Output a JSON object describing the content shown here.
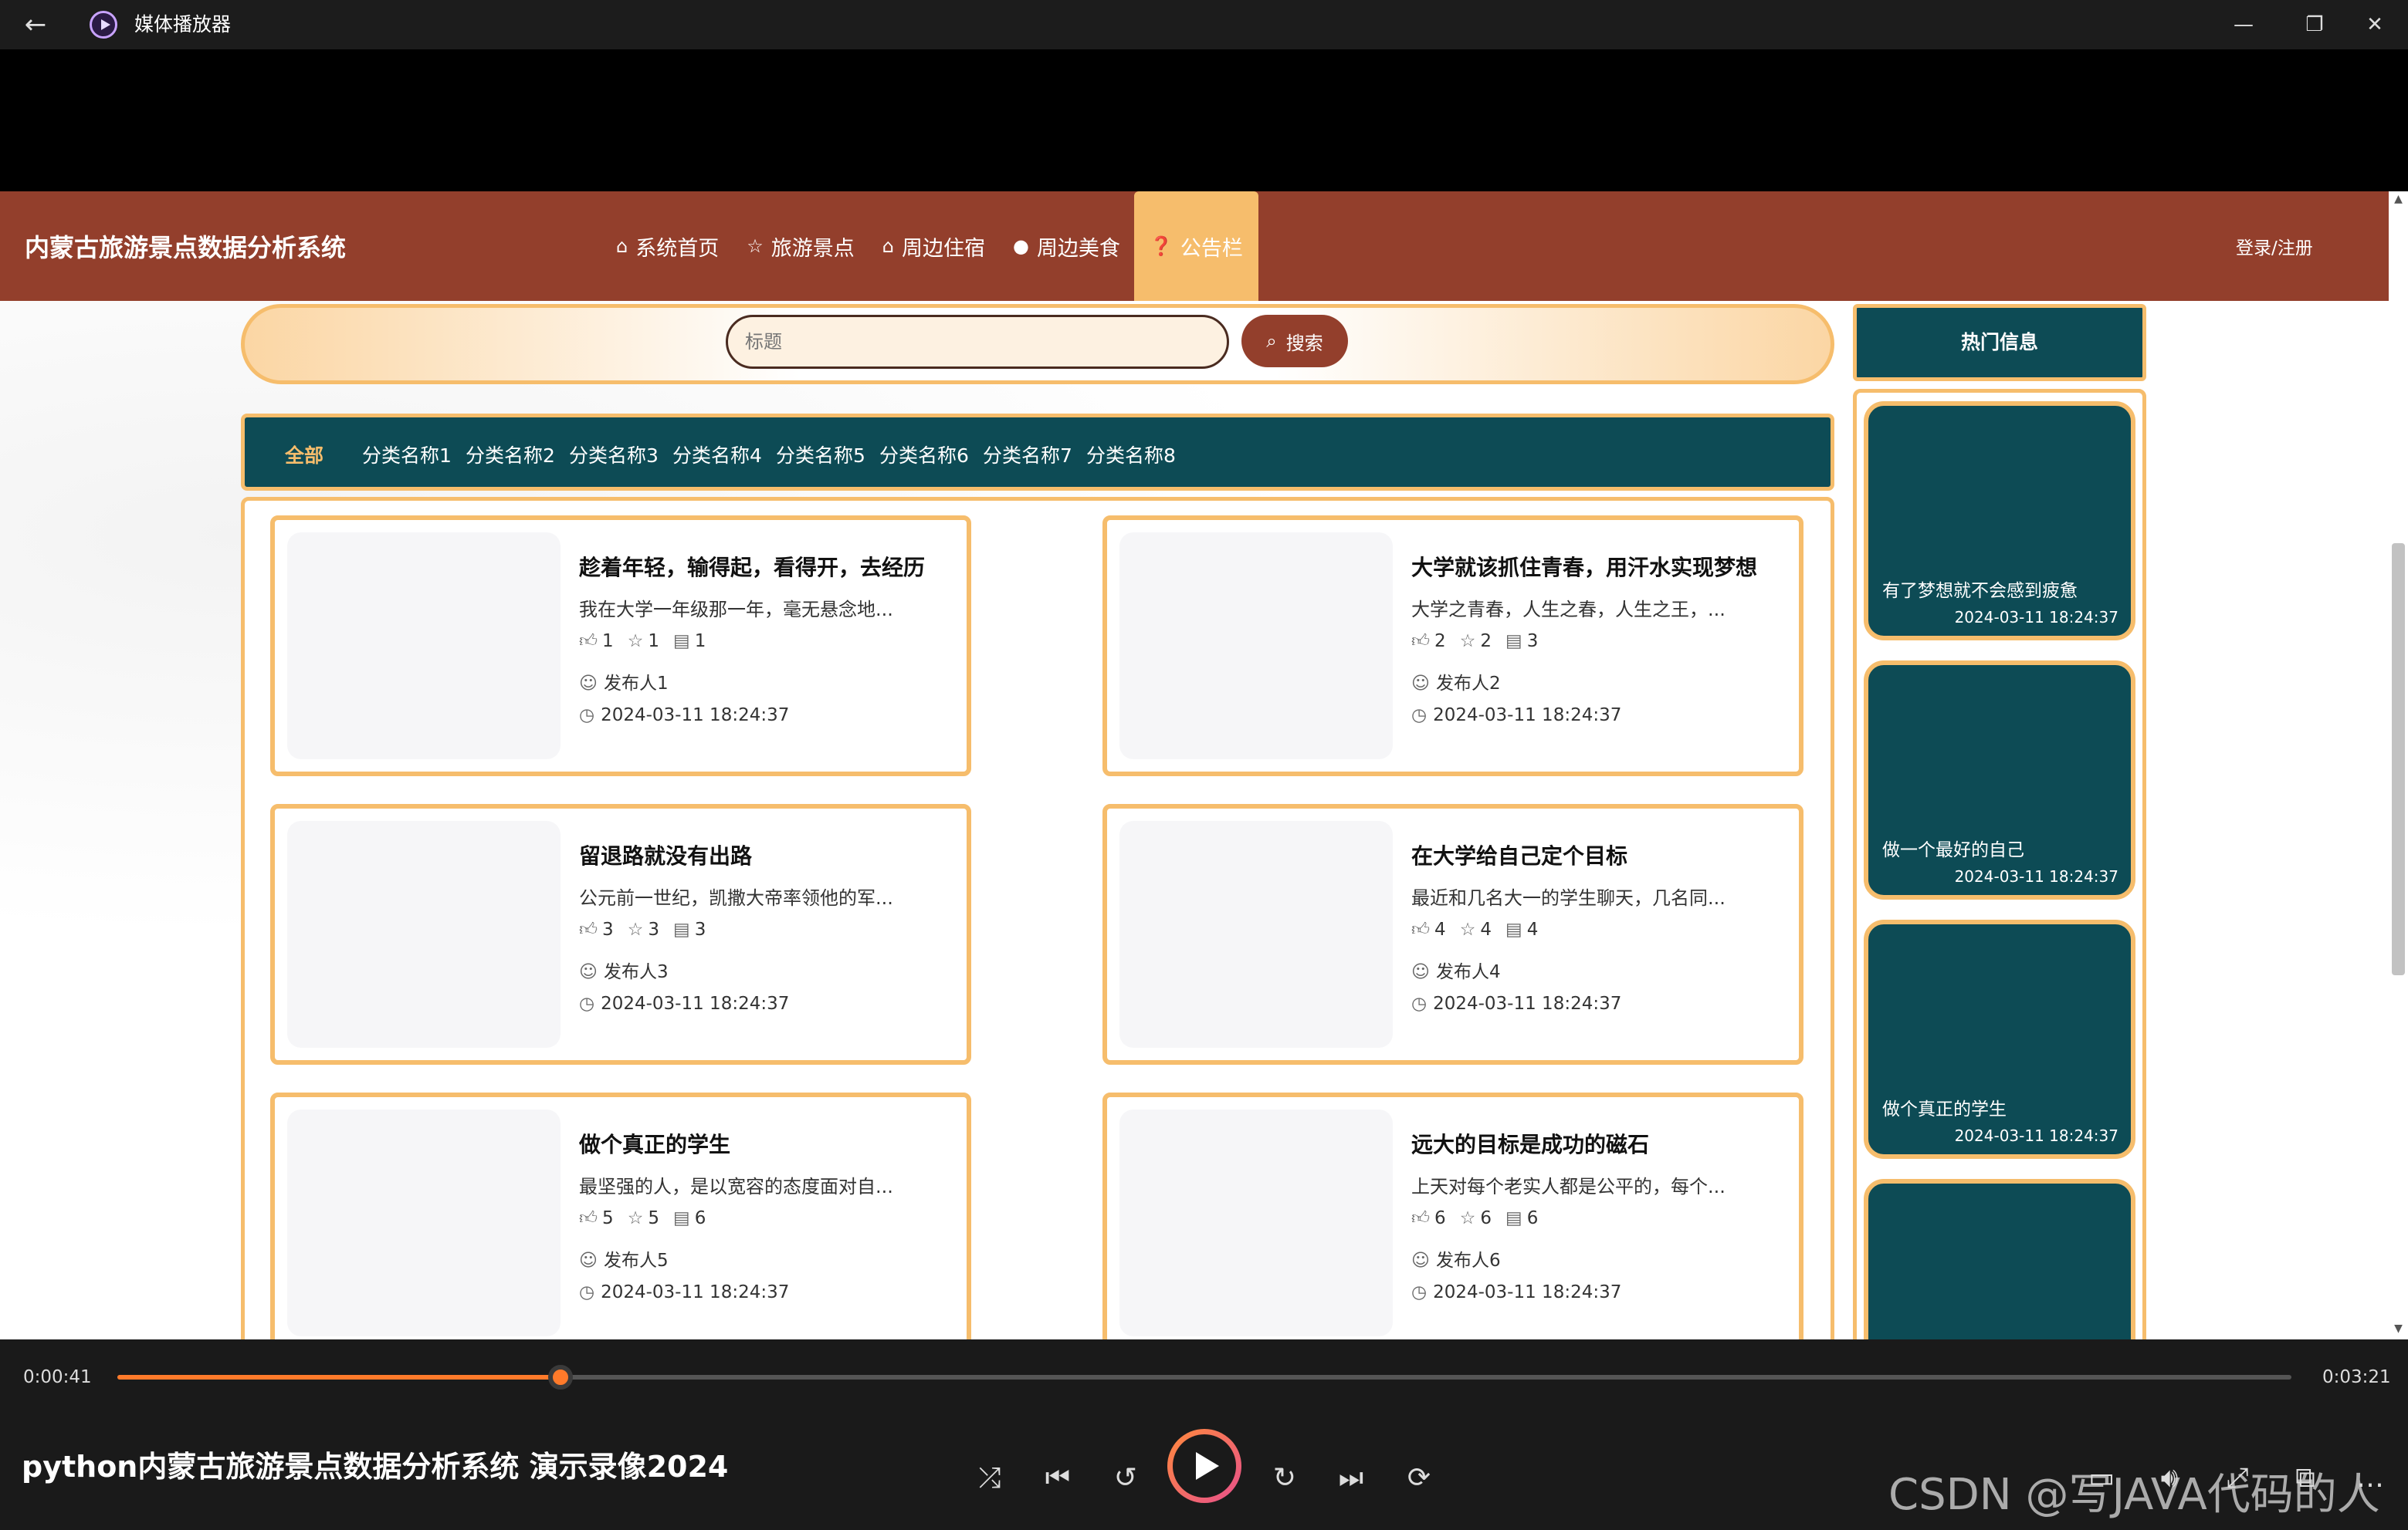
{
  "window": {
    "app_title": "媒体播放器"
  },
  "site": {
    "title": "内蒙古旅游景点数据分析系统",
    "nav": [
      {
        "label": "系统首页",
        "icon": "home-icon"
      },
      {
        "label": "旅游景点",
        "icon": "star-icon"
      },
      {
        "label": "周边住宿",
        "icon": "bag-icon"
      },
      {
        "label": "周边美食",
        "icon": "info-icon"
      },
      {
        "label": "公告栏",
        "icon": "help-icon"
      }
    ],
    "active_nav": "公告栏",
    "login": "登录/注册"
  },
  "search": {
    "placeholder": "标题",
    "button": "搜索"
  },
  "categories": [
    "全部",
    "分类名称1",
    "分类名称2",
    "分类名称3",
    "分类名称4",
    "分类名称5",
    "分类名称6",
    "分类名称7",
    "分类名称8"
  ],
  "active_category": "全部",
  "articles": [
    {
      "title": "趁着年轻，输得起，看得开，去经历",
      "desc": "我在大学一年级那一年，毫无悬念地...",
      "likes": "1",
      "favs": "1",
      "comments": "1",
      "author": "发布人1",
      "time": "2024-03-11 18:24:37"
    },
    {
      "title": "大学就该抓住青春，用汗水实现梦想",
      "desc": "大学之青春，人生之春，人生之王，...",
      "likes": "2",
      "favs": "2",
      "comments": "3",
      "author": "发布人2",
      "time": "2024-03-11 18:24:37"
    },
    {
      "title": "留退路就没有出路",
      "desc": "公元前一世纪，凯撒大帝率领他的军...",
      "likes": "3",
      "favs": "3",
      "comments": "3",
      "author": "发布人3",
      "time": "2024-03-11 18:24:37"
    },
    {
      "title": "在大学给自己定个目标",
      "desc": "最近和几名大一的学生聊天，几名同...",
      "likes": "4",
      "favs": "4",
      "comments": "4",
      "author": "发布人4",
      "time": "2024-03-11 18:24:37"
    },
    {
      "title": "做个真正的学生",
      "desc": "最坚强的人，是以宽容的态度面对自...",
      "likes": "5",
      "favs": "5",
      "comments": "6",
      "author": "发布人5",
      "time": "2024-03-11 18:24:37"
    },
    {
      "title": "远大的目标是成功的磁石",
      "desc": "上天对每个老实人都是公平的，每个...",
      "likes": "6",
      "favs": "6",
      "comments": "6",
      "author": "发布人6",
      "time": "2024-03-11 18:24:37"
    }
  ],
  "sidebar": {
    "heading": "热门信息",
    "items": [
      {
        "title": "有了梦想就不会感到疲惫",
        "time": "2024-03-11 18:24:37"
      },
      {
        "title": "做一个最好的自己",
        "time": "2024-03-11 18:24:37"
      },
      {
        "title": "做个真正的学生",
        "time": "2024-03-11 18:24:37"
      },
      {
        "title": "",
        "time": ""
      }
    ]
  },
  "player": {
    "current_time": "0:00:41",
    "total_time": "0:03:21",
    "progress": 0.204,
    "video_title": "python内蒙古旅游景点数据分析系统 演示录像2024",
    "watermark": "CSDN @写JAVA代码的人",
    "accent": "#ff7a2a"
  },
  "colors": {
    "header": "#933f2c",
    "accent": "#f6bd6c",
    "teal": "#0d4b55"
  }
}
